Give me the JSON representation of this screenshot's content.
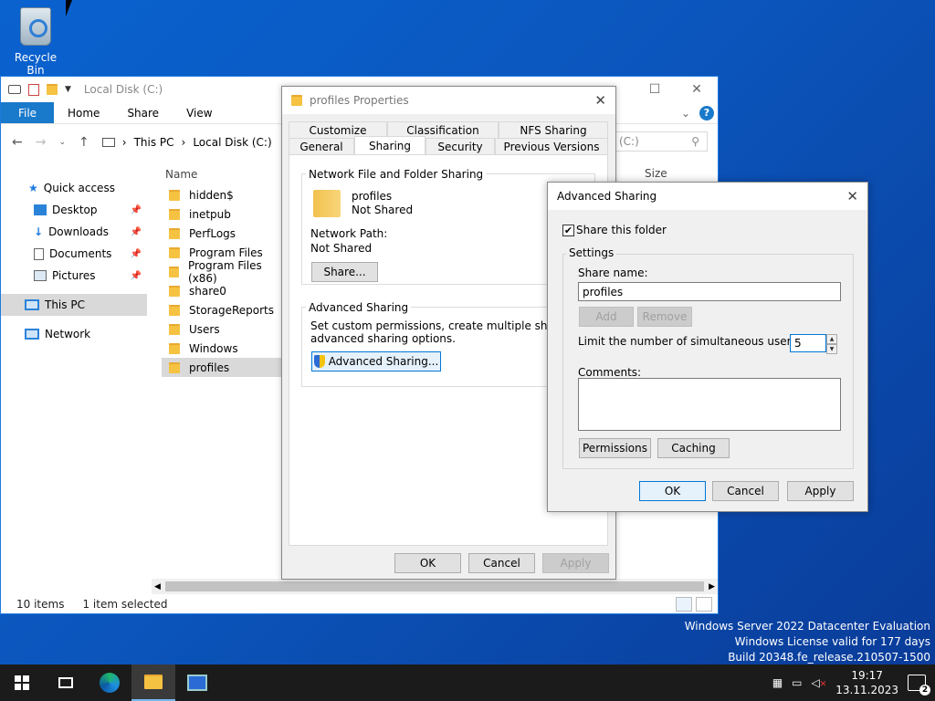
{
  "desktop": {
    "recycle_bin": "Recycle Bin"
  },
  "explorer": {
    "title": "Local Disk (C:)",
    "ribbon": {
      "file": "File",
      "tabs": [
        "Home",
        "Share",
        "View"
      ]
    },
    "address": {
      "crumbs": [
        "This PC",
        "Local Disk (C:)"
      ],
      "search_placeholder": "(C:)"
    },
    "nav": {
      "quick_access": "Quick access",
      "items": [
        "Desktop",
        "Downloads",
        "Documents",
        "Pictures"
      ],
      "this_pc": "This PC",
      "network": "Network"
    },
    "columns": {
      "name": "Name",
      "size": "Size"
    },
    "files": [
      "hidden$",
      "inetpub",
      "PerfLogs",
      "Program Files",
      "Program Files (x86)",
      "share0",
      "StorageReports",
      "Users",
      "Windows",
      "profiles"
    ],
    "selected_file": "profiles",
    "status": {
      "count": "10 items",
      "selected": "1 item selected"
    }
  },
  "properties": {
    "title": "profiles Properties",
    "tabs_top": [
      "Customize",
      "Classification",
      "NFS Sharing"
    ],
    "tabs_bottom": [
      "General",
      "Sharing",
      "Security",
      "Previous Versions"
    ],
    "active_tab": "Sharing",
    "group1": "Network File and Folder Sharing",
    "folder_name": "profiles",
    "folder_state": "Not Shared",
    "network_path_label": "Network Path:",
    "network_path_value": "Not Shared",
    "share_button": "Share...",
    "group2": "Advanced Sharing",
    "adv_desc1": "Set custom permissions, create multiple shares, and set",
    "adv_desc2": "advanced sharing options.",
    "adv_button": "Advanced Sharing...",
    "ok": "OK",
    "cancel": "Cancel",
    "apply": "Apply"
  },
  "advanced": {
    "title": "Advanced Sharing",
    "share_checkbox": "Share this folder",
    "share_checked": true,
    "settings": "Settings",
    "share_name_label": "Share name:",
    "share_name_value": "profiles",
    "add": "Add",
    "remove": "Remove",
    "limit_label": "Limit the number of simultaneous users to:",
    "limit_value": "5",
    "comments_label": "Comments:",
    "permissions": "Permissions",
    "caching": "Caching",
    "ok": "OK",
    "cancel": "Cancel",
    "apply": "Apply"
  },
  "watermark": {
    "line1": "Windows Server 2022 Datacenter Evaluation",
    "line2": "Windows License valid for 177 days",
    "line3": "Build 20348.fe_release.210507-1500"
  },
  "taskbar": {
    "time": "19:17",
    "date": "13.11.2023",
    "notifications": "2"
  }
}
